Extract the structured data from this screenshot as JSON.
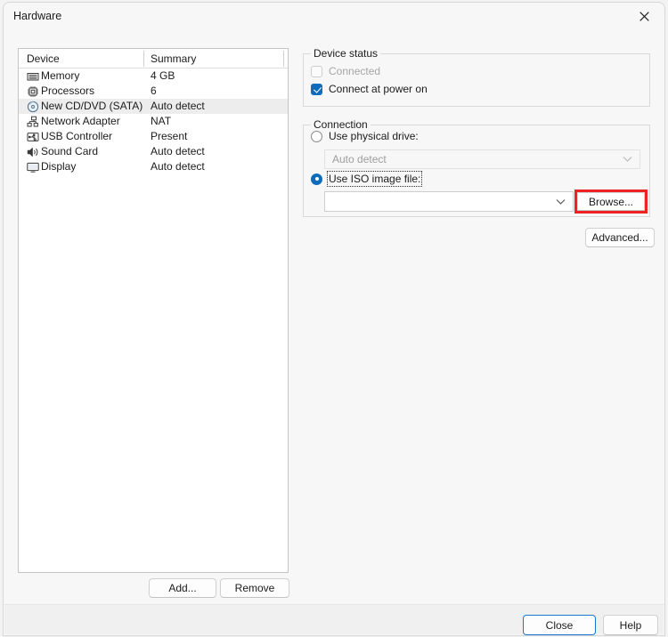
{
  "window": {
    "title": "Hardware",
    "close_icon": "close-icon"
  },
  "device_list": {
    "columns": [
      "Device",
      "Summary"
    ],
    "rows": [
      {
        "icon": "memory-icon",
        "device": "Memory",
        "summary": "4 GB",
        "selected": false
      },
      {
        "icon": "processor-icon",
        "device": "Processors",
        "summary": "6",
        "selected": false
      },
      {
        "icon": "cd-dvd-icon",
        "device": "New CD/DVD (SATA)",
        "summary": "Auto detect",
        "selected": true
      },
      {
        "icon": "network-adapter-icon",
        "device": "Network Adapter",
        "summary": "NAT",
        "selected": false
      },
      {
        "icon": "usb-controller-icon",
        "device": "USB Controller",
        "summary": "Present",
        "selected": false
      },
      {
        "icon": "sound-card-icon",
        "device": "Sound Card",
        "summary": "Auto detect",
        "selected": false
      },
      {
        "icon": "display-icon",
        "device": "Display",
        "summary": "Auto detect",
        "selected": false
      }
    ],
    "add_label": "Add...",
    "remove_label": "Remove"
  },
  "device_status": {
    "legend": "Device status",
    "connected": {
      "label": "Connected",
      "checked": false,
      "disabled": true
    },
    "connect_at_power_on": {
      "label": "Connect at power on",
      "checked": true,
      "disabled": false
    }
  },
  "connection": {
    "legend": "Connection",
    "use_physical_drive": {
      "label": "Use physical drive:",
      "selected": false
    },
    "physical_drive_combo": {
      "value": "Auto detect",
      "disabled": true
    },
    "use_iso_image_file": {
      "label": "Use ISO image file:",
      "selected": true,
      "focused": true
    },
    "iso_combo": {
      "value": "",
      "placeholder": "",
      "disabled": false
    },
    "browse_label": "Browse...",
    "advanced_label": "Advanced..."
  },
  "footer": {
    "close_label": "Close",
    "help_label": "Help"
  },
  "colors": {
    "accent": "#0f6cbd",
    "highlight_box": "#ef2223",
    "selected_row": "#ededed",
    "default_button_border": "#1b78d0"
  }
}
